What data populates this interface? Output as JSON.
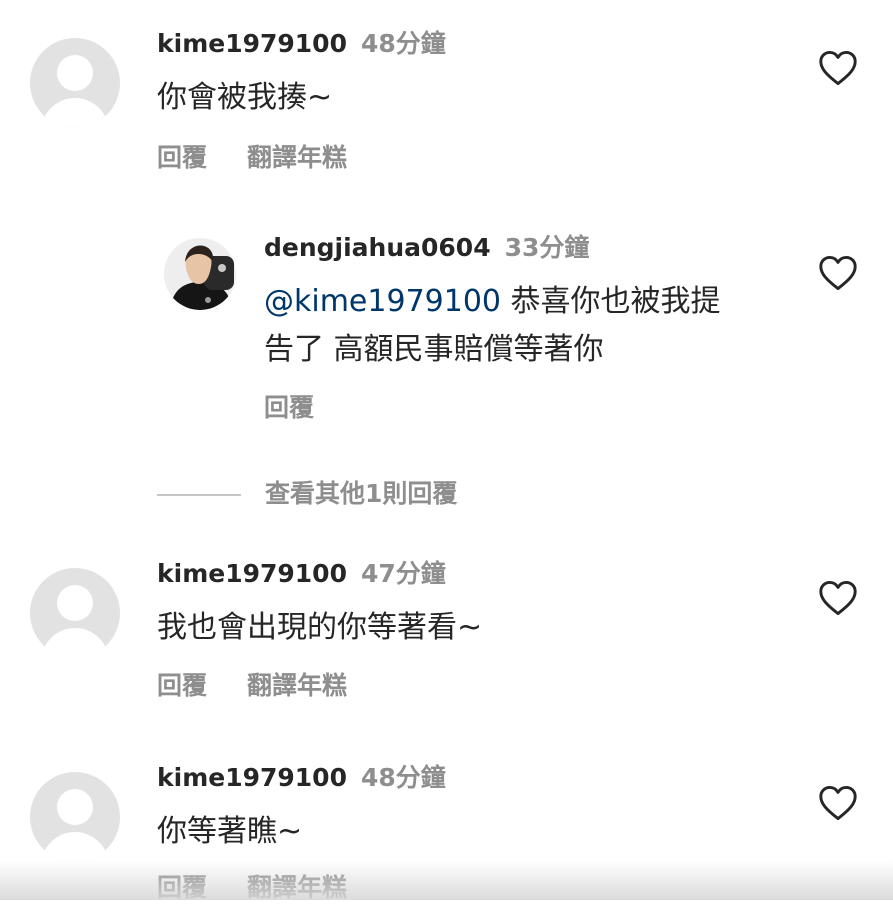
{
  "comments": [
    {
      "username": "kime1979100",
      "time": "48分鐘",
      "text": "你會被我揍~",
      "reply_label": "回覆",
      "translate_label": "翻譯年糕"
    },
    {
      "username": "dengjiahua0604",
      "time": "33分鐘",
      "mention": "@kime1979100",
      "text_line1": " 恭喜你也被我提",
      "text_line2": "告了 高額民事賠償等著你",
      "reply_label": "回覆"
    },
    {
      "username": "kime1979100",
      "time": "47分鐘",
      "text": "我也會出現的你等著看~",
      "reply_label": "回覆",
      "translate_label": "翻譯年糕"
    },
    {
      "username": "kime1979100",
      "time": "48分鐘",
      "text": "你等著瞧~",
      "reply_label": "回覆",
      "translate_label": "翻譯年糕"
    }
  ],
  "view_replies_label": "查看其他1則回覆",
  "icons": {
    "like": "heart-outline-icon",
    "avatar_default": "default-avatar-icon"
  },
  "colors": {
    "text": "#262626",
    "secondary": "#8e8e8e",
    "mention": "#00376b"
  }
}
